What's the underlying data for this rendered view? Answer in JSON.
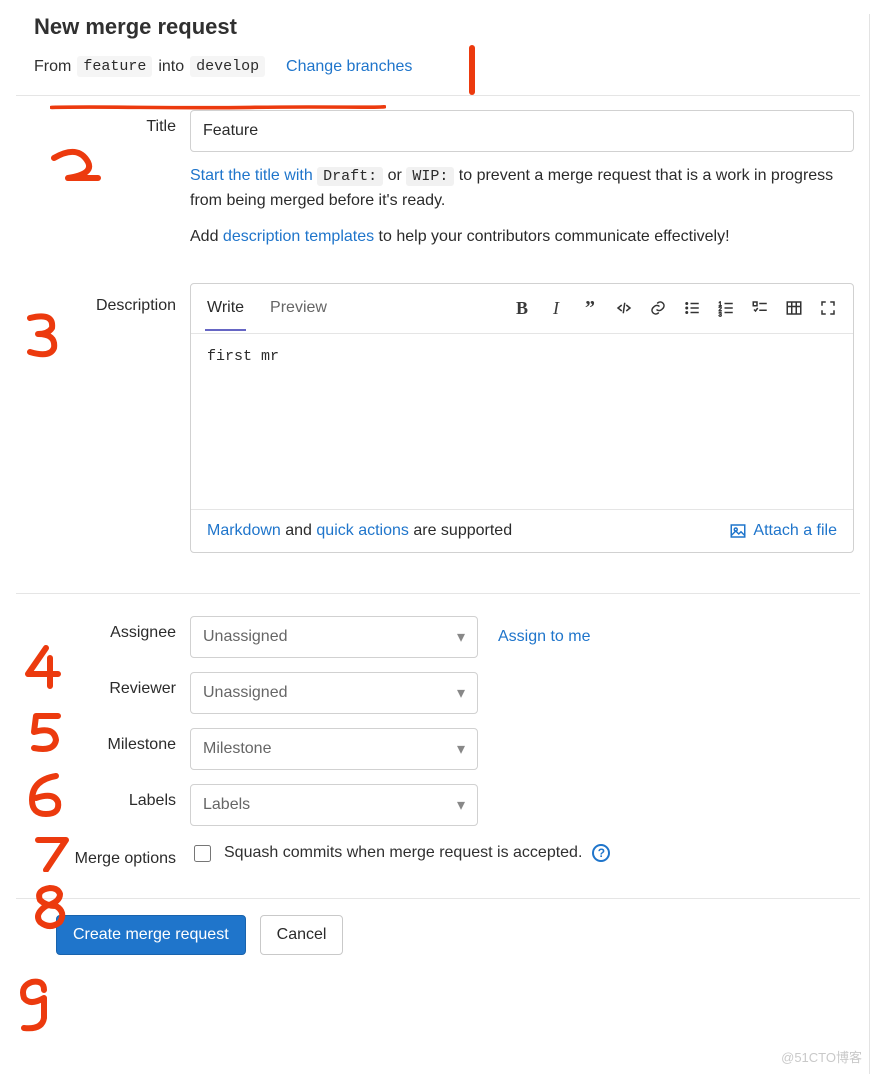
{
  "page_title": "New merge request",
  "branches": {
    "from_label": "From",
    "source": "feature",
    "into_label": "into",
    "target": "develop",
    "change_link": "Change branches"
  },
  "title_field": {
    "label": "Title",
    "value": "Feature",
    "hint_prefix": "Start the title with ",
    "hint_code1": "Draft:",
    "hint_or": " or ",
    "hint_code2": "WIP:",
    "hint_suffix": " to prevent a merge request that is a work in progress from being merged before it's ready.",
    "templates_prefix": "Add ",
    "templates_link": "description templates",
    "templates_suffix": " to help your contributors communicate effectively!"
  },
  "description": {
    "label": "Description",
    "tab_write": "Write",
    "tab_preview": "Preview",
    "body": "first mr",
    "footer_markdown": "Markdown",
    "footer_and": " and ",
    "footer_quick": "quick actions",
    "footer_supp": " are supported",
    "attach": "Attach a file"
  },
  "assignee": {
    "label": "Assignee",
    "value": "Unassigned",
    "assign_me": "Assign to me"
  },
  "reviewer": {
    "label": "Reviewer",
    "value": "Unassigned"
  },
  "milestone": {
    "label": "Milestone",
    "value": "Milestone"
  },
  "labels": {
    "label": "Labels",
    "value": "Labels"
  },
  "merge_options": {
    "label": "Merge options",
    "squash": "Squash commits when merge request is accepted."
  },
  "buttons": {
    "submit": "Create merge request",
    "cancel": "Cancel"
  },
  "watermark": "@51CTO博客",
  "annotations": {
    "n1": "1",
    "n2": "2",
    "n3": "3",
    "n4": "4",
    "n5": "5",
    "n6": "6",
    "n7": "7",
    "n8": "8",
    "n9": "9"
  }
}
